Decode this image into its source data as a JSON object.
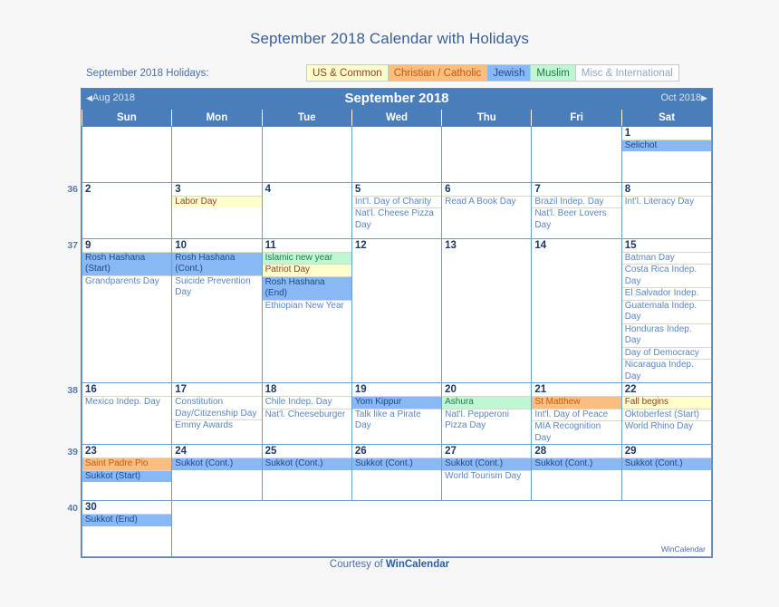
{
  "page": {
    "title": "September 2018 Calendar with Holidays",
    "footer_prefix": "Courtesy of ",
    "footer_brand": "WinCalendar",
    "watermark": "WinCalendar"
  },
  "legend": {
    "label": "September 2018 Holidays:",
    "items": [
      {
        "label": "US & Common",
        "key": "us",
        "bg": "#FFFFCC",
        "fg": "#963C2E"
      },
      {
        "label": "Christian / Catholic",
        "key": "chr",
        "bg": "#FBBE7F",
        "fg": "#C55A11"
      },
      {
        "label": "Jewish",
        "key": "jew",
        "bg": "#89B9F5",
        "fg": "#20478F"
      },
      {
        "label": "Muslim",
        "key": "mus",
        "bg": "#BFF7D3",
        "fg": "#1F7A4D"
      },
      {
        "label": "Misc & International",
        "key": "misc",
        "bg": "#FFFFFF",
        "fg": "#8FA9C9"
      }
    ]
  },
  "calendar": {
    "month_title": "September 2018",
    "prev_label": "Aug 2018",
    "next_label": "Oct 2018",
    "daynames": [
      "Sun",
      "Mon",
      "Tue",
      "Wed",
      "Thu",
      "Fri",
      "Sat"
    ],
    "week_numbers": [
      "36",
      "37",
      "38",
      "39",
      "40"
    ],
    "weeks": [
      {
        "number": "",
        "days": [
          {
            "num": "",
            "blank": true
          },
          {
            "num": "",
            "blank": true
          },
          {
            "num": "",
            "blank": true
          },
          {
            "num": "",
            "blank": true
          },
          {
            "num": "",
            "blank": true
          },
          {
            "num": "",
            "blank": true
          },
          {
            "num": "1",
            "weekend": true,
            "events": [
              {
                "text": "Selichot",
                "type": "jew"
              }
            ]
          }
        ]
      },
      {
        "number": "36",
        "days": [
          {
            "num": "2",
            "weekend": true,
            "events": []
          },
          {
            "num": "3",
            "events": [
              {
                "text": "Labor Day",
                "type": "us"
              }
            ]
          },
          {
            "num": "4",
            "events": []
          },
          {
            "num": "5",
            "events": [
              {
                "text": "Int'l. Day of Charity",
                "type": "misc"
              },
              {
                "text": "Nat'l. Cheese Pizza Day",
                "type": "misc"
              }
            ]
          },
          {
            "num": "6",
            "events": [
              {
                "text": "Read A Book Day",
                "type": "misc"
              }
            ]
          },
          {
            "num": "7",
            "events": [
              {
                "text": "Brazil Indep. Day",
                "type": "misc"
              },
              {
                "text": "Nat'l. Beer Lovers Day",
                "type": "misc"
              }
            ]
          },
          {
            "num": "8",
            "weekend": true,
            "events": [
              {
                "text": "Int'l. Literacy Day",
                "type": "misc"
              }
            ]
          }
        ]
      },
      {
        "number": "37",
        "days": [
          {
            "num": "9",
            "weekend": true,
            "events": [
              {
                "text": "Rosh Hashana (Start)",
                "type": "jew"
              },
              {
                "text": "Grandparents Day",
                "type": "misc"
              }
            ]
          },
          {
            "num": "10",
            "events": [
              {
                "text": "Rosh Hashana (Cont.)",
                "type": "jew"
              },
              {
                "text": "Suicide Prevention Day",
                "type": "misc"
              }
            ]
          },
          {
            "num": "11",
            "events": [
              {
                "text": "Islamic new year",
                "type": "mus"
              },
              {
                "text": "Patriot Day",
                "type": "us"
              },
              {
                "text": "Rosh Hashana (End)",
                "type": "jew"
              },
              {
                "text": "Ethiopian New Year",
                "type": "misc"
              }
            ]
          },
          {
            "num": "12",
            "events": []
          },
          {
            "num": "13",
            "events": []
          },
          {
            "num": "14",
            "events": []
          },
          {
            "num": "15",
            "weekend": true,
            "events": [
              {
                "text": "Batman Day",
                "type": "misc"
              },
              {
                "text": "Costa Rica Indep. Day",
                "type": "misc"
              },
              {
                "text": "El Salvador Indep.",
                "type": "misc"
              },
              {
                "text": "Guatemala Indep. Day",
                "type": "misc"
              },
              {
                "text": "Honduras Indep. Day",
                "type": "misc"
              },
              {
                "text": "Day of Democracy",
                "type": "misc"
              },
              {
                "text": "Nicaragua Indep. Day",
                "type": "misc"
              }
            ]
          }
        ]
      },
      {
        "number": "38",
        "days": [
          {
            "num": "16",
            "weekend": true,
            "events": [
              {
                "text": "Mexico Indep. Day",
                "type": "misc"
              }
            ]
          },
          {
            "num": "17",
            "events": [
              {
                "text": "Constitution Day/Citizenship Day",
                "type": "misc"
              },
              {
                "text": "Emmy Awards",
                "type": "misc"
              }
            ]
          },
          {
            "num": "18",
            "events": [
              {
                "text": "Chile Indep. Day",
                "type": "misc"
              },
              {
                "text": "Nat'l. Cheeseburger",
                "type": "misc"
              }
            ]
          },
          {
            "num": "19",
            "events": [
              {
                "text": "Yom Kippur",
                "type": "jew"
              },
              {
                "text": "Talk like a Pirate Day",
                "type": "misc"
              }
            ]
          },
          {
            "num": "20",
            "events": [
              {
                "text": "Ashura",
                "type": "mus"
              },
              {
                "text": "Nat'l. Pepperoni Pizza Day",
                "type": "misc"
              }
            ]
          },
          {
            "num": "21",
            "events": [
              {
                "text": "St Matthew",
                "type": "chr"
              },
              {
                "text": "Int'l. Day of Peace",
                "type": "misc"
              },
              {
                "text": "MIA Recognition Day",
                "type": "misc"
              }
            ]
          },
          {
            "num": "22",
            "weekend": true,
            "events": [
              {
                "text": "Fall begins",
                "type": "us"
              },
              {
                "text": "Oktoberfest (Start)",
                "type": "misc"
              },
              {
                "text": "World Rhino Day",
                "type": "misc"
              }
            ]
          }
        ]
      },
      {
        "number": "39",
        "days": [
          {
            "num": "23",
            "weekend": true,
            "events": [
              {
                "text": "Saint Padre Pio",
                "type": "chr"
              },
              {
                "text": "Sukkot (Start)",
                "type": "jew"
              }
            ]
          },
          {
            "num": "24",
            "events": [
              {
                "text": "Sukkot (Cont.)",
                "type": "jew"
              }
            ]
          },
          {
            "num": "25",
            "events": [
              {
                "text": "Sukkot (Cont.)",
                "type": "jew"
              }
            ]
          },
          {
            "num": "26",
            "events": [
              {
                "text": "Sukkot (Cont.)",
                "type": "jew"
              }
            ]
          },
          {
            "num": "27",
            "events": [
              {
                "text": "Sukkot (Cont.)",
                "type": "jew"
              },
              {
                "text": "World Tourism Day",
                "type": "misc"
              }
            ]
          },
          {
            "num": "28",
            "events": [
              {
                "text": "Sukkot (Cont.)",
                "type": "jew"
              }
            ]
          },
          {
            "num": "29",
            "weekend": true,
            "events": [
              {
                "text": "Sukkot (Cont.)",
                "type": "jew"
              }
            ]
          }
        ]
      },
      {
        "number": "40",
        "days": [
          {
            "num": "30",
            "weekend": true,
            "events": [
              {
                "text": "Sukkot (End)",
                "type": "jew"
              }
            ]
          },
          {
            "num": "",
            "blank": true,
            "span": 6
          }
        ]
      }
    ]
  }
}
